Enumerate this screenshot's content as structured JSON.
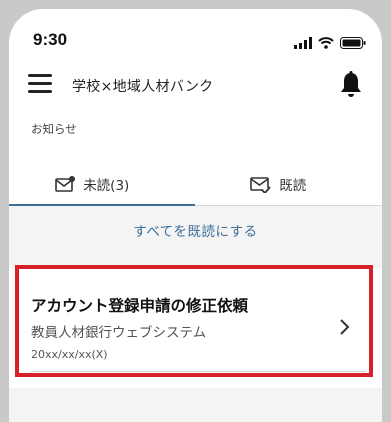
{
  "status_bar": {
    "time": "9:30",
    "signal_icon": "signal-icon",
    "wifi_icon": "wifi-icon",
    "battery_icon": "battery-icon"
  },
  "header": {
    "title": "学校×地域人材バンク",
    "menu_icon": "hamburger-menu-icon",
    "bell_icon": "bell-icon"
  },
  "section_label": "お知らせ",
  "tabs": [
    {
      "label": "未読(3)",
      "icon": "mail-unread-icon",
      "active": true
    },
    {
      "label": "既読",
      "icon": "mail-read-icon",
      "active": false
    }
  ],
  "mark_all_label": "すべてを既読にする",
  "notification": {
    "title": "アカウント登録申請の修正依頼",
    "sender": "教員人材銀行ウェブシステム",
    "date": "20xx/xx/xx(X)"
  },
  "colors": {
    "accent": "#3f6f99",
    "highlight": "#d8202a",
    "frame": "#c9c9c9"
  }
}
